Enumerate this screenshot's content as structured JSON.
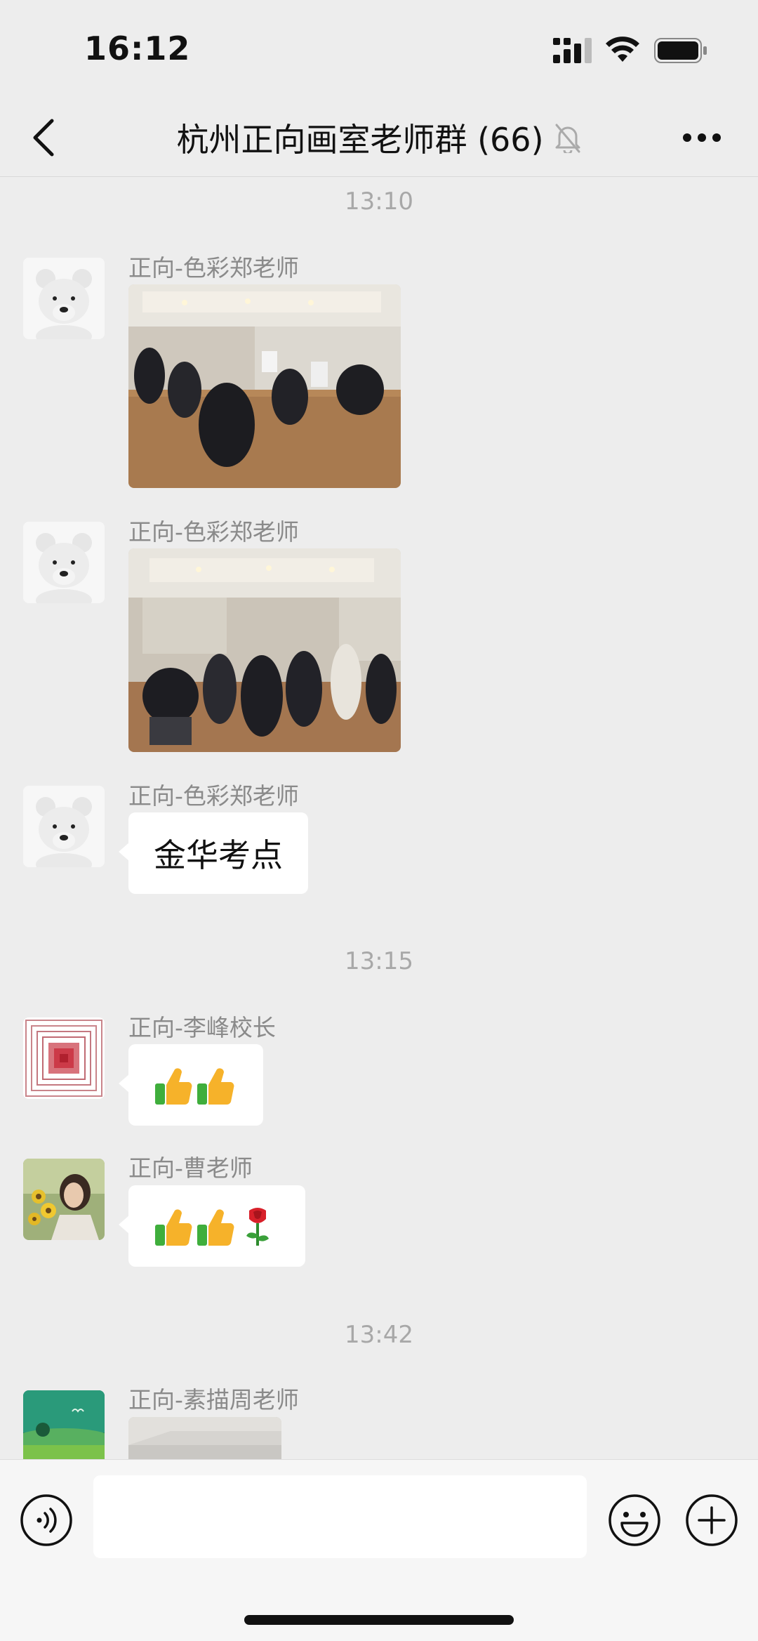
{
  "status_bar": {
    "time": "16:12"
  },
  "nav": {
    "title": "杭州正向画室老师群 (66)"
  },
  "chat": {
    "timestamps": [
      "13:10",
      "13:15",
      "13:42"
    ],
    "messages": [
      {
        "sender": "正向-色彩郑老师",
        "type": "image",
        "avatar": "polar-bear"
      },
      {
        "sender": "正向-色彩郑老师",
        "type": "image",
        "avatar": "polar-bear"
      },
      {
        "sender": "正向-色彩郑老师",
        "type": "text",
        "text": "金华考点",
        "avatar": "polar-bear"
      },
      {
        "sender": "正向-李峰校长",
        "type": "emoji",
        "emojis": [
          "thumbs-up",
          "thumbs-up"
        ],
        "avatar": "red-squares"
      },
      {
        "sender": "正向-曹老师",
        "type": "emoji",
        "emojis": [
          "thumbs-up",
          "thumbs-up",
          "rose"
        ],
        "avatar": "girl-sunflowers"
      },
      {
        "sender": "正向-素描周老师",
        "type": "image",
        "avatar": "green-landscape"
      }
    ]
  },
  "input": {
    "placeholder": ""
  },
  "colors": {
    "background": "#ededed",
    "bubble": "#ffffff",
    "timestamp": "#a8a8a8",
    "sender": "#8a8a8a"
  }
}
